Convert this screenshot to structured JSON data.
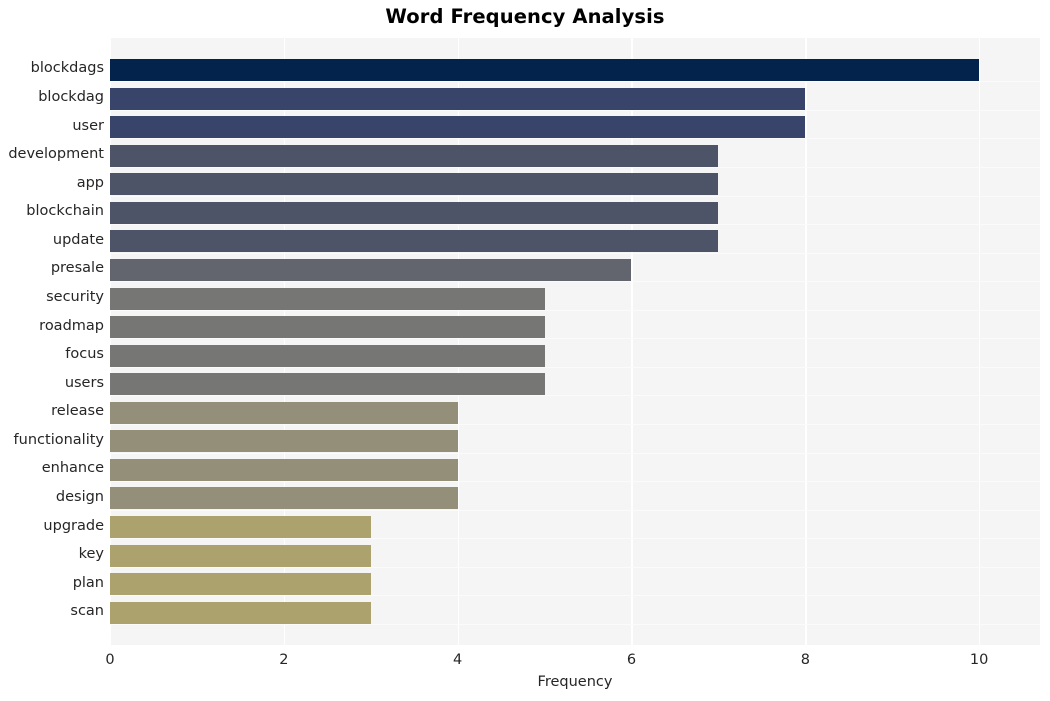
{
  "chart_data": {
    "type": "bar",
    "orientation": "horizontal",
    "title": "Word Frequency Analysis",
    "xlabel": "Frequency",
    "ylabel": "",
    "categories": [
      "blockdags",
      "blockdag",
      "user",
      "development",
      "app",
      "blockchain",
      "update",
      "presale",
      "security",
      "roadmap",
      "focus",
      "users",
      "release",
      "functionality",
      "enhance",
      "design",
      "upgrade",
      "key",
      "plan",
      "scan"
    ],
    "values": [
      10,
      8,
      8,
      7,
      7,
      7,
      7,
      6,
      5,
      5,
      5,
      5,
      4,
      4,
      4,
      4,
      3,
      3,
      3,
      3
    ],
    "bar_colors": [
      "#04234c",
      "#384469",
      "#384469",
      "#4e5468",
      "#4e5468",
      "#4e5468",
      "#4e5468",
      "#62646e",
      "#767674",
      "#767674",
      "#767674",
      "#767674",
      "#938f78",
      "#938f78",
      "#938f78",
      "#938f78",
      "#aca26d",
      "#aca26d",
      "#aca26d",
      "#aca26d"
    ],
    "xlim": [
      0,
      10.7
    ],
    "xticks": [
      0,
      2,
      4,
      6,
      8,
      10
    ],
    "xtick_labels": [
      "0",
      "2",
      "4",
      "6",
      "8",
      "10"
    ],
    "grid": true,
    "grid_axis": "x",
    "grid_color": "#ffffff",
    "plot_background": "#f5f5f5",
    "figure_background": "#ffffff",
    "legend": null,
    "style": "seaborn-whitegrid"
  }
}
